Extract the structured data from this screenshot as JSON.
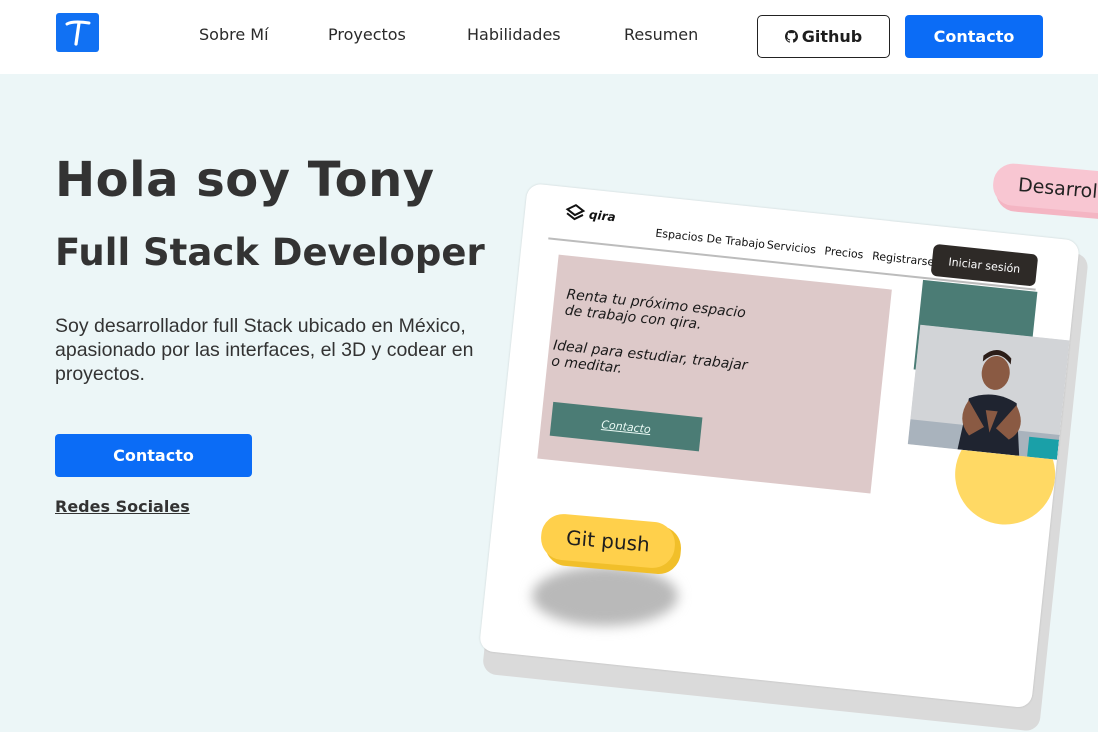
{
  "nav": {
    "logo_icon": "t-logo-icon",
    "links": [
      "Sobre Mí",
      "Proyectos",
      "Habilidades",
      "Resumen"
    ],
    "github_label": "Github",
    "github_icon": "github-icon",
    "contact_label": "Contacto"
  },
  "hero": {
    "title": "Hola soy Tony",
    "subtitle": "Full Stack Developer",
    "description": "Soy desarrollador full Stack ubicado en México, apasionado por las interfaces, el 3D y codear en proyectos.",
    "contact_label": "Contacto",
    "social_label": "Redes Sociales"
  },
  "mockup": {
    "logo_text": "qira",
    "nav": [
      "Espacios De Trabajo",
      "Servicios",
      "Precios",
      "Registrarse"
    ],
    "login_label": "Iniciar sesión",
    "headline_1": "Renta tu próximo espacio\nde trabajo con qira.",
    "headline_2": "Ideal para estudiar, trabajar\no meditar.",
    "button_label": "Contacto"
  },
  "tags": {
    "developer": "Desarrollador",
    "git": "Git push"
  },
  "colors": {
    "primary": "#0b6cf6",
    "background": "#ecf6f7",
    "card_pink": "#ddc9c9",
    "teal": "#4b7c75",
    "yellow": "#ffd964",
    "tag_pink": "#f8c6d2"
  }
}
